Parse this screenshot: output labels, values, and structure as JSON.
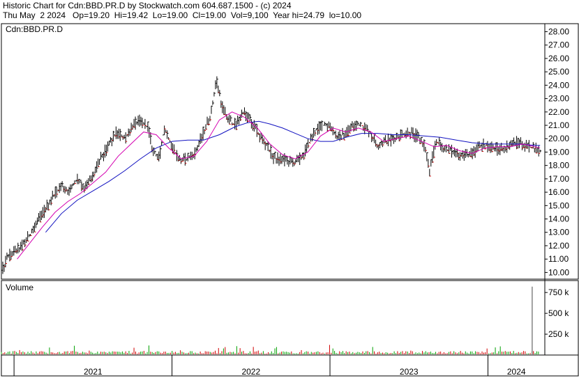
{
  "header": {
    "line1": "Historic Chart for Cdn:BBD.PR.D by Stockwatch.com 604.687.1500 - (c) 2024",
    "line2": "Thu May  2 2024   Op=19.20  Hi=19.42  Lo=19.00  Cl=19.00  Vol=9,100  Year hi=24.79  lo=10.00"
  },
  "chart_data": {
    "type": "line",
    "symbol_label": "Cdn:BBD.PR.D",
    "volume_label": "Volume",
    "price_axis": {
      "ylim": [
        9.5,
        28.6
      ],
      "ticks": [
        "28.00",
        "27.00",
        "26.00",
        "25.00",
        "24.00",
        "23.00",
        "22.00",
        "21.00",
        "20.00",
        "19.00",
        "18.00",
        "17.00",
        "16.00",
        "15.00",
        "14.00",
        "13.00",
        "12.00",
        "11.00",
        "10.00"
      ]
    },
    "volume_axis": {
      "ylim": [
        0,
        860000
      ],
      "ticks": [
        {
          "label": "750 k",
          "value": 750000
        },
        {
          "label": "500 k",
          "value": 500000
        },
        {
          "label": "250 k",
          "value": 250000
        }
      ]
    },
    "x_axis": {
      "xlim": [
        2020.92,
        2024.36
      ],
      "years": [
        {
          "label": "2021",
          "start": 2021.0
        },
        {
          "label": "2022",
          "start": 2022.0
        },
        {
          "label": "2023",
          "start": 2023.0
        },
        {
          "label": "2024",
          "start": 2024.0
        }
      ]
    },
    "price_keypoints": [
      [
        2020.92,
        10.0
      ],
      [
        2020.96,
        11.2
      ],
      [
        2021.04,
        11.8
      ],
      [
        2021.1,
        12.8
      ],
      [
        2021.15,
        13.8
      ],
      [
        2021.2,
        14.8
      ],
      [
        2021.25,
        15.8
      ],
      [
        2021.3,
        16.5
      ],
      [
        2021.35,
        16.0
      ],
      [
        2021.4,
        17.0
      ],
      [
        2021.45,
        16.3
      ],
      [
        2021.5,
        17.2
      ],
      [
        2021.55,
        18.5
      ],
      [
        2021.6,
        19.5
      ],
      [
        2021.65,
        20.5
      ],
      [
        2021.7,
        20.0
      ],
      [
        2021.75,
        21.0
      ],
      [
        2021.8,
        21.3
      ],
      [
        2021.85,
        20.8
      ],
      [
        2021.88,
        19.0
      ],
      [
        2021.92,
        18.5
      ],
      [
        2021.95,
        20.8
      ],
      [
        2022.0,
        19.5
      ],
      [
        2022.05,
        18.3
      ],
      [
        2022.1,
        18.5
      ],
      [
        2022.15,
        19.0
      ],
      [
        2022.2,
        20.5
      ],
      [
        2022.25,
        22.0
      ],
      [
        2022.28,
        24.5
      ],
      [
        2022.32,
        22.3
      ],
      [
        2022.35,
        21.5
      ],
      [
        2022.4,
        21.0
      ],
      [
        2022.45,
        22.0
      ],
      [
        2022.5,
        21.3
      ],
      [
        2022.55,
        20.3
      ],
      [
        2022.6,
        19.5
      ],
      [
        2022.65,
        18.5
      ],
      [
        2022.7,
        18.5
      ],
      [
        2022.75,
        18.2
      ],
      [
        2022.8,
        18.3
      ],
      [
        2022.85,
        19.2
      ],
      [
        2022.9,
        20.5
      ],
      [
        2022.95,
        21.0
      ],
      [
        2023.0,
        21.0
      ],
      [
        2023.05,
        20.0
      ],
      [
        2023.1,
        20.5
      ],
      [
        2023.15,
        21.0
      ],
      [
        2023.2,
        21.0
      ],
      [
        2023.25,
        20.5
      ],
      [
        2023.3,
        19.5
      ],
      [
        2023.35,
        19.8
      ],
      [
        2023.4,
        20.0
      ],
      [
        2023.45,
        20.3
      ],
      [
        2023.5,
        20.5
      ],
      [
        2023.55,
        20.2
      ],
      [
        2023.6,
        19.5
      ],
      [
        2023.63,
        17.5
      ],
      [
        2023.67,
        19.8
      ],
      [
        2023.72,
        19.3
      ],
      [
        2023.78,
        19.0
      ],
      [
        2023.85,
        18.8
      ],
      [
        2023.9,
        18.8
      ],
      [
        2023.95,
        19.5
      ],
      [
        2024.0,
        19.5
      ],
      [
        2024.05,
        19.2
      ],
      [
        2024.1,
        19.3
      ],
      [
        2024.15,
        19.6
      ],
      [
        2024.2,
        19.8
      ],
      [
        2024.25,
        19.4
      ],
      [
        2024.3,
        19.3
      ],
      [
        2024.33,
        19.0
      ]
    ],
    "ma_short": [
      [
        2021.02,
        11.0
      ],
      [
        2021.1,
        12.2
      ],
      [
        2021.18,
        13.4
      ],
      [
        2021.26,
        14.5
      ],
      [
        2021.34,
        15.3
      ],
      [
        2021.42,
        15.9
      ],
      [
        2021.5,
        16.7
      ],
      [
        2021.58,
        17.5
      ],
      [
        2021.66,
        18.7
      ],
      [
        2021.74,
        19.6
      ],
      [
        2021.82,
        20.5
      ],
      [
        2021.9,
        20.3
      ],
      [
        2021.98,
        19.3
      ],
      [
        2022.06,
        18.5
      ],
      [
        2022.14,
        18.7
      ],
      [
        2022.22,
        19.8
      ],
      [
        2022.3,
        21.4
      ],
      [
        2022.38,
        22.0
      ],
      [
        2022.46,
        21.6
      ],
      [
        2022.54,
        20.8
      ],
      [
        2022.62,
        19.6
      ],
      [
        2022.7,
        18.8
      ],
      [
        2022.78,
        18.5
      ],
      [
        2022.86,
        19.0
      ],
      [
        2022.94,
        20.2
      ],
      [
        2023.02,
        20.8
      ],
      [
        2023.1,
        20.5
      ],
      [
        2023.18,
        20.8
      ],
      [
        2023.26,
        20.5
      ],
      [
        2023.34,
        19.8
      ],
      [
        2023.42,
        20.0
      ],
      [
        2023.5,
        20.2
      ],
      [
        2023.58,
        19.8
      ],
      [
        2023.66,
        19.4
      ],
      [
        2023.74,
        19.5
      ],
      [
        2023.82,
        19.1
      ],
      [
        2023.9,
        18.9
      ],
      [
        2023.98,
        19.3
      ],
      [
        2024.06,
        19.4
      ],
      [
        2024.14,
        19.4
      ],
      [
        2024.22,
        19.6
      ],
      [
        2024.3,
        19.4
      ],
      [
        2024.33,
        19.3
      ]
    ],
    "ma_long": [
      [
        2021.2,
        13.0
      ],
      [
        2021.3,
        14.4
      ],
      [
        2021.4,
        15.4
      ],
      [
        2021.5,
        16.1
      ],
      [
        2021.6,
        16.8
      ],
      [
        2021.7,
        17.6
      ],
      [
        2021.8,
        18.5
      ],
      [
        2021.9,
        19.3
      ],
      [
        2022.0,
        19.8
      ],
      [
        2022.1,
        19.9
      ],
      [
        2022.2,
        19.9
      ],
      [
        2022.3,
        20.3
      ],
      [
        2022.4,
        20.9
      ],
      [
        2022.48,
        21.2
      ],
      [
        2022.55,
        21.3
      ],
      [
        2022.62,
        21.1
      ],
      [
        2022.7,
        20.8
      ],
      [
        2022.78,
        20.4
      ],
      [
        2022.86,
        20.0
      ],
      [
        2022.94,
        19.8
      ],
      [
        2023.02,
        19.8
      ],
      [
        2023.1,
        20.1
      ],
      [
        2023.2,
        20.4
      ],
      [
        2023.3,
        20.4
      ],
      [
        2023.4,
        20.3
      ],
      [
        2023.5,
        20.3
      ],
      [
        2023.6,
        20.2
      ],
      [
        2023.7,
        20.1
      ],
      [
        2023.8,
        19.9
      ],
      [
        2023.9,
        19.7
      ],
      [
        2024.0,
        19.6
      ],
      [
        2024.1,
        19.6
      ],
      [
        2024.2,
        19.6
      ],
      [
        2024.3,
        19.5
      ],
      [
        2024.33,
        19.5
      ]
    ],
    "volume_spike": {
      "x": 2024.28,
      "value": 820000
    }
  },
  "colors": {
    "price": "#000000",
    "ma_short": "#d400b0",
    "ma_long": "#1010c0",
    "volume_up": "#00a000",
    "volume_down": "#d00000",
    "volume_spike": "#a0a0a0",
    "frame": "#000000"
  }
}
